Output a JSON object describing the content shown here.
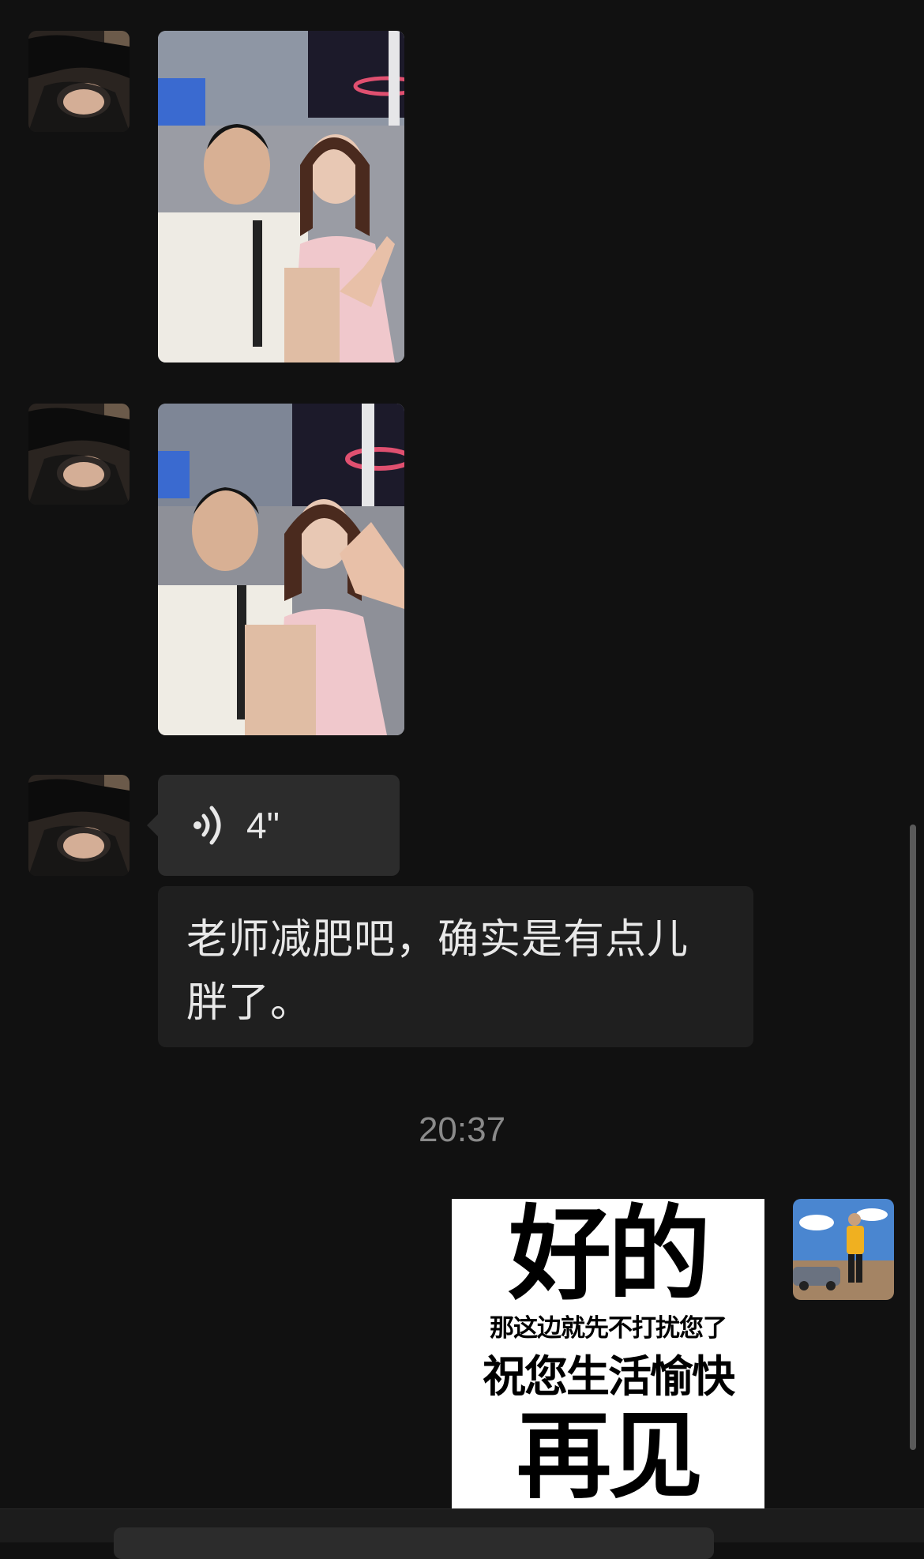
{
  "chat": {
    "messages": [
      {
        "type": "image",
        "from": "other"
      },
      {
        "type": "image",
        "from": "other"
      },
      {
        "type": "voice",
        "from": "other",
        "duration": "4\""
      },
      {
        "type": "text",
        "from": "other",
        "text": "老师减肥吧，确实是有点儿胖了。"
      },
      {
        "type": "sticker",
        "from": "self"
      }
    ],
    "voice_duration": "4\"",
    "text_message": "老师减肥吧，确实是有点儿胖了。",
    "timestamp": "20:37",
    "sticker": {
      "line1": "好的",
      "line2": "那这边就先不打扰您了",
      "line3": "祝您生活愉快",
      "line4": "再见"
    }
  },
  "icons": {
    "voice": "voice-wave-icon"
  },
  "colors": {
    "background": "#111111",
    "bubble_voice": "#2c2c2c",
    "bubble_text": "#1f1f1f",
    "timestamp": "#8a8a8a"
  }
}
